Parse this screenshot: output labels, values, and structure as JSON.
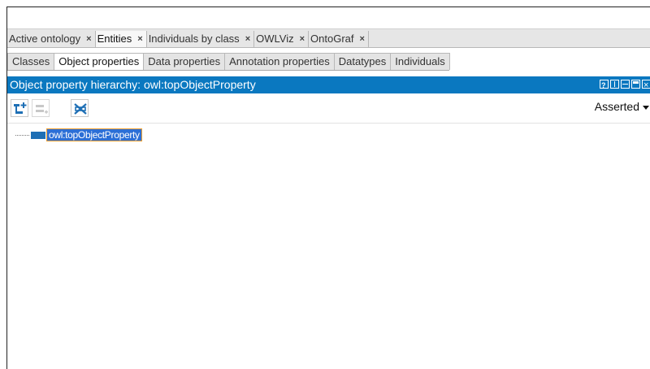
{
  "main_tabs": [
    {
      "label": "Active ontology",
      "close": "×"
    },
    {
      "label": "Entities",
      "close": "×"
    },
    {
      "label": "Individuals by class",
      "close": "×"
    },
    {
      "label": "OWLViz",
      "close": "×"
    },
    {
      "label": "OntoGraf",
      "close": "×"
    }
  ],
  "sub_tabs": [
    {
      "label": "Classes"
    },
    {
      "label": "Object properties"
    },
    {
      "label": "Data properties"
    },
    {
      "label": "Annotation properties"
    },
    {
      "label": "Datatypes"
    },
    {
      "label": "Individuals"
    }
  ],
  "view": {
    "title": "Object property hierarchy: owl:topObjectProperty",
    "mode_select": "Asserted"
  },
  "tree": {
    "root": "owl:topObjectProperty"
  },
  "colors": {
    "header_blue": "#0a78c0",
    "selection": "#2c6fd6",
    "selection_border": "#f0a030"
  }
}
